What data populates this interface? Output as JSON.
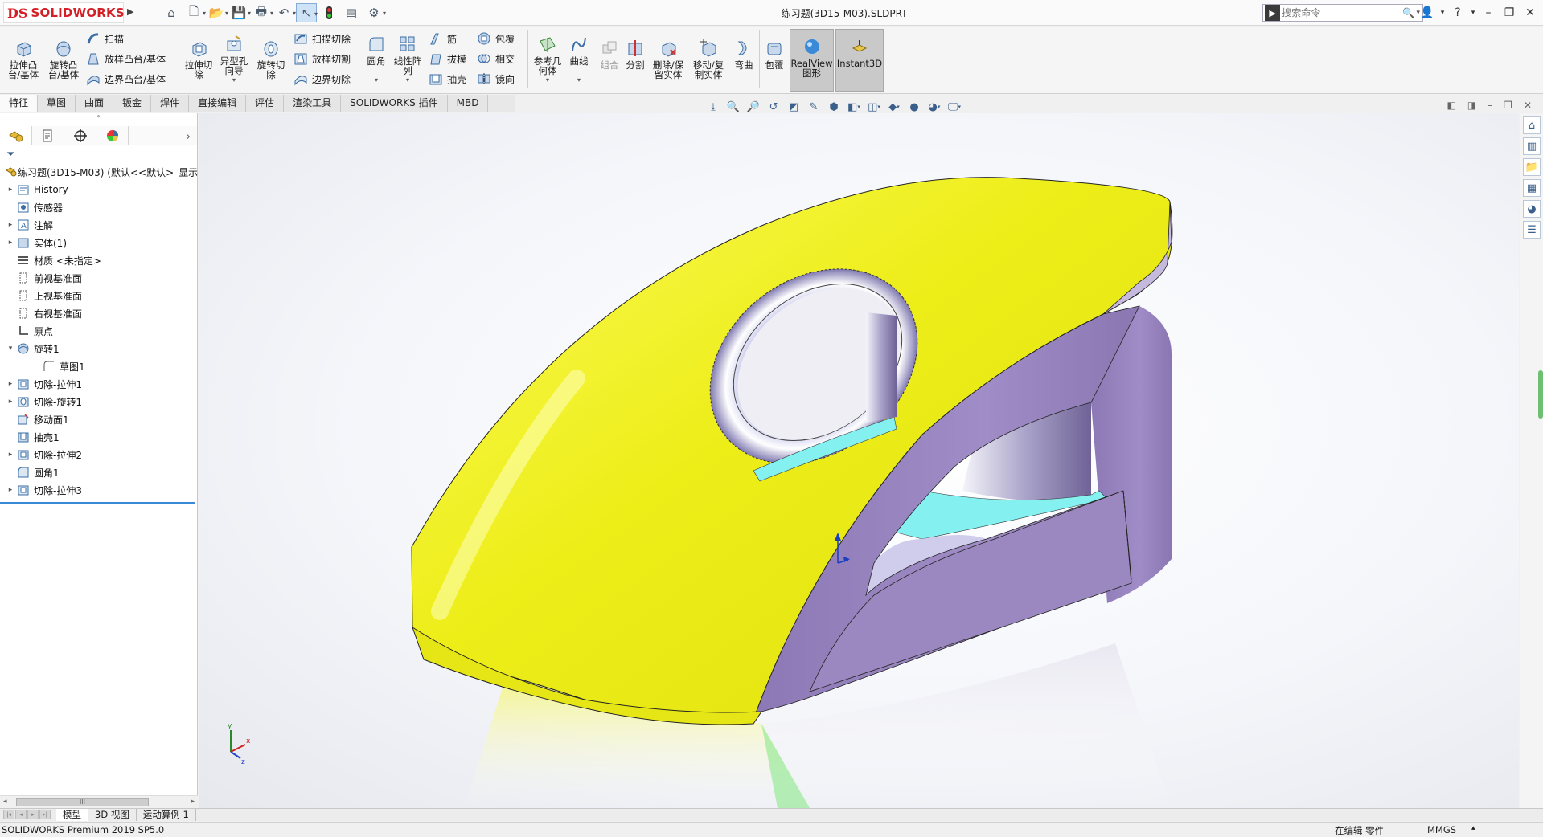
{
  "app": {
    "brand": "SOLIDWORKS",
    "brand_mark": "DS"
  },
  "document": {
    "title": "练习题(3D15-M03).SLDPRT"
  },
  "search": {
    "placeholder": "搜索命令"
  },
  "ribbon": {
    "extrude_boss": [
      "拉伸凸",
      "台/基体"
    ],
    "revolve_boss": [
      "旋转凸",
      "台/基体"
    ],
    "sweep": "扫描",
    "loft": "放样凸台/基体",
    "boundary": "边界凸台/基体",
    "extrude_cut": [
      "拉伸切",
      "除"
    ],
    "hole_wizard": [
      "异型孔",
      "向导"
    ],
    "revolve_cut": [
      "旋转切",
      "除"
    ],
    "sweep_cut": "扫描切除",
    "loft_cut": "放样切割",
    "boundary_cut": "边界切除",
    "fillet": "圆角",
    "linear_pattern": [
      "线性阵",
      "列"
    ],
    "rib": "筋",
    "draft": "拔模",
    "shell": "抽壳",
    "wrap": "包覆",
    "intersect": "相交",
    "mirror": "镜向",
    "ref_geometry": [
      "参考几",
      "何体"
    ],
    "curves": "曲线",
    "combine": "组合",
    "split": "分割",
    "delete_keep": [
      "删除/保",
      "留实体"
    ],
    "move_copy": [
      "移动/复",
      "制实体"
    ],
    "flex": "弯曲",
    "wrap2": "包覆",
    "realview": [
      "RealView",
      "图形"
    ],
    "instant3d": "Instant3D"
  },
  "tabs": [
    "特征",
    "草图",
    "曲面",
    "钣金",
    "焊件",
    "直接编辑",
    "评估",
    "渲染工具",
    "SOLIDWORKS 插件",
    "MBD"
  ],
  "feature_tree": {
    "root": "练习题(3D15-M03)  (默认<<默认>_显示",
    "items": [
      {
        "label": "History",
        "icon": "history-icon",
        "toggle": "▸"
      },
      {
        "label": "传感器",
        "icon": "sensor-icon",
        "toggle": ""
      },
      {
        "label": "注解",
        "icon": "annotation-icon",
        "toggle": "▸"
      },
      {
        "label": "实体(1)",
        "icon": "solid-body-icon",
        "toggle": "▸"
      },
      {
        "label": "材质 <未指定>",
        "icon": "material-icon",
        "toggle": ""
      },
      {
        "label": "前视基准面",
        "icon": "plane-icon",
        "toggle": ""
      },
      {
        "label": "上视基准面",
        "icon": "plane-icon",
        "toggle": ""
      },
      {
        "label": "右视基准面",
        "icon": "plane-icon",
        "toggle": ""
      },
      {
        "label": "原点",
        "icon": "origin-icon",
        "toggle": ""
      },
      {
        "label": "旋转1",
        "icon": "revolve-icon",
        "toggle": "▾"
      },
      {
        "label": "草图1",
        "icon": "sketch-icon",
        "toggle": ""
      },
      {
        "label": "切除-拉伸1",
        "icon": "cut-extrude-icon",
        "toggle": "▸"
      },
      {
        "label": "切除-旋转1",
        "icon": "cut-revolve-icon",
        "toggle": "▸"
      },
      {
        "label": "移动面1",
        "icon": "move-face-icon",
        "toggle": ""
      },
      {
        "label": "抽壳1",
        "icon": "shell-icon",
        "toggle": ""
      },
      {
        "label": "切除-拉伸2",
        "icon": "cut-extrude-icon",
        "toggle": "▸"
      },
      {
        "label": "圆角1",
        "icon": "fillet-icon",
        "toggle": ""
      },
      {
        "label": "切除-拉伸3",
        "icon": "cut-extrude-icon",
        "toggle": "▸"
      }
    ]
  },
  "bottom_tabs": [
    "模型",
    "3D 视图",
    "运动算例 1"
  ],
  "status": {
    "version": "SOLIDWORKS Premium 2019 SP5.0",
    "mode": "在编辑 零件",
    "units": "MMGS"
  },
  "colors": {
    "top_face": "#f2f21c",
    "side_face": "#9b86c0",
    "inner_face": "#84f0f0",
    "accent_blue": "#3a8ad8"
  },
  "triad": {
    "x": "x",
    "y": "y",
    "z": "z"
  }
}
